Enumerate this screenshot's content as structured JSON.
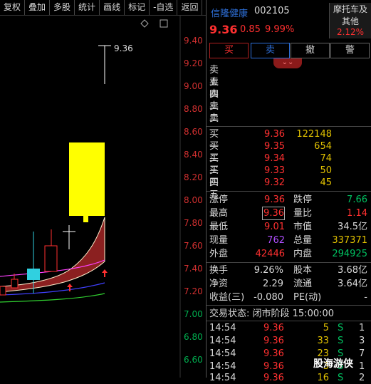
{
  "toolbar": {
    "buttons": [
      "复权",
      "叠加",
      "多股",
      "统计",
      "画线",
      "标记",
      "-自选",
      "返回"
    ]
  },
  "chart": {
    "y_labels": [
      "9.40",
      "9.20",
      "9.00",
      "8.80",
      "8.60",
      "8.40",
      "8.20",
      "8.00",
      "7.80",
      "7.60",
      "7.40",
      "7.20",
      "7.00",
      "6.80",
      "6.60"
    ],
    "high_annotation": "9.36"
  },
  "stock": {
    "name": "信隆健康",
    "code": "002105",
    "price": "9.36",
    "change": "0.85",
    "change_pct": "9.99%"
  },
  "sector": {
    "line1": "摩托车及",
    "line2": "其他",
    "pct": "2.12%"
  },
  "actions": {
    "buy": "买",
    "sell": "卖",
    "cancel": "撤",
    "alert": "警"
  },
  "sell_orders": [
    {
      "label": "卖五",
      "price": "",
      "vol": ""
    },
    {
      "label": "卖四",
      "price": "",
      "vol": ""
    },
    {
      "label": "卖三",
      "price": "",
      "vol": ""
    },
    {
      "label": "卖二",
      "price": "",
      "vol": ""
    },
    {
      "label": "卖一",
      "price": "",
      "vol": ""
    }
  ],
  "buy_orders": [
    {
      "label": "买一",
      "price": "9.36",
      "vol": "122148"
    },
    {
      "label": "买二",
      "price": "9.35",
      "vol": "654"
    },
    {
      "label": "买三",
      "price": "9.34",
      "vol": "74"
    },
    {
      "label": "买四",
      "price": "9.33",
      "vol": "50"
    },
    {
      "label": "买五",
      "price": "9.32",
      "vol": "45"
    }
  ],
  "stats": {
    "limit_up_label": "涨停",
    "limit_up": "9.36",
    "limit_down_label": "跌停",
    "limit_down": "7.66",
    "high_label": "最高",
    "high": "9.36",
    "vol_ratio_label": "量比",
    "vol_ratio": "1.14",
    "low_label": "最低",
    "low": "9.01",
    "mcap_label": "市值",
    "mcap": "34.5亿",
    "cur_vol_label": "现量",
    "cur_vol": "762",
    "total_vol_label": "总量",
    "total_vol": "337371",
    "outer_label": "外盘",
    "outer": "42446",
    "inner_label": "内盘",
    "inner": "294925",
    "turnover_label": "换手",
    "turnover": "9.26%",
    "equity_label": "股本",
    "equity": "3.68亿",
    "nav_label": "净资",
    "nav": "2.29",
    "float_label": "流通",
    "float": "3.64亿",
    "eps_label": "收益(三)",
    "eps": "-0.080",
    "pe_label": "PE(动)",
    "pe": "-"
  },
  "trade_status": "交易状态: 闭市阶段 15:00:00",
  "ticks": [
    {
      "time": "14:54",
      "price": "9.36",
      "vol": "5",
      "side": "S",
      "count": "1"
    },
    {
      "time": "14:54",
      "price": "9.36",
      "vol": "33",
      "side": "S",
      "count": "3"
    },
    {
      "time": "14:54",
      "price": "9.36",
      "vol": "23",
      "side": "S",
      "count": "7"
    },
    {
      "time": "14:54",
      "price": "9.36",
      "vol": "3",
      "side": "S",
      "count": "1"
    },
    {
      "time": "14:54",
      "price": "9.36",
      "vol": "16",
      "side": "S",
      "count": "2"
    }
  ],
  "watermark": "股海游侠",
  "colors": {
    "up": "#ff3030",
    "down": "#00c060",
    "volume": "#e0c000",
    "link": "#2e6fd8"
  }
}
